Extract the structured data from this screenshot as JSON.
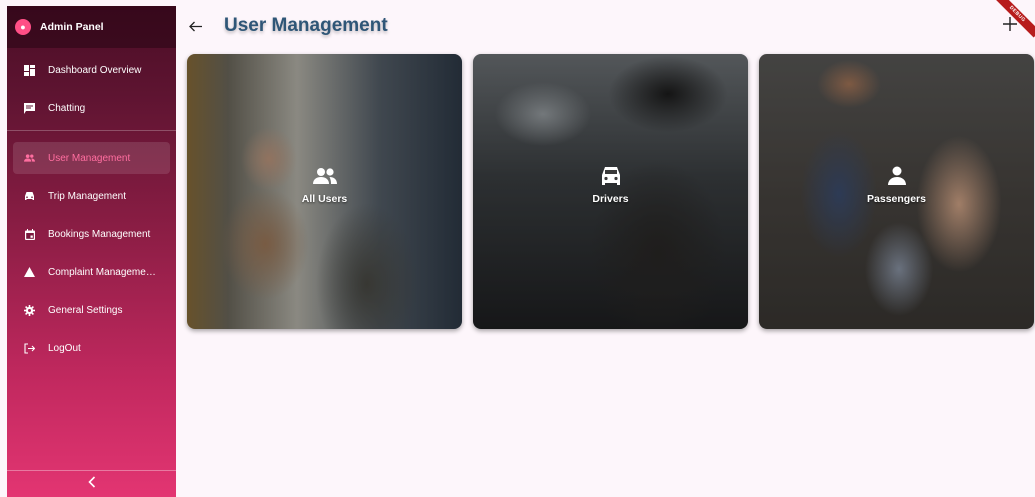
{
  "sidebar": {
    "brand": "Admin Panel",
    "items": [
      {
        "label": "Dashboard Overview",
        "icon": "dashboard-icon"
      },
      {
        "label": "Chatting",
        "icon": "chat-icon"
      },
      {
        "label": "User Management",
        "icon": "people-icon",
        "active": true
      },
      {
        "label": "Trip Management",
        "icon": "car-icon"
      },
      {
        "label": "Bookings Management",
        "icon": "calendar-icon"
      },
      {
        "label": "Complaint Manageme…",
        "icon": "warning-icon"
      },
      {
        "label": "General Settings",
        "icon": "gear-icon"
      },
      {
        "label": "LogOut",
        "icon": "logout-icon"
      }
    ]
  },
  "header": {
    "title": "User Management"
  },
  "debug_banner": "DEBUG",
  "cards": [
    {
      "label": "All Users",
      "icon": "people-icon"
    },
    {
      "label": "Drivers",
      "icon": "car-icon"
    },
    {
      "label": "Passengers",
      "icon": "person-icon"
    }
  ],
  "colors": {
    "accent": "#ff6ea0",
    "title": "#2f5677",
    "sidebar_top": "#4a0d25",
    "sidebar_bottom": "#e33572",
    "background": "#fdf6fb"
  }
}
